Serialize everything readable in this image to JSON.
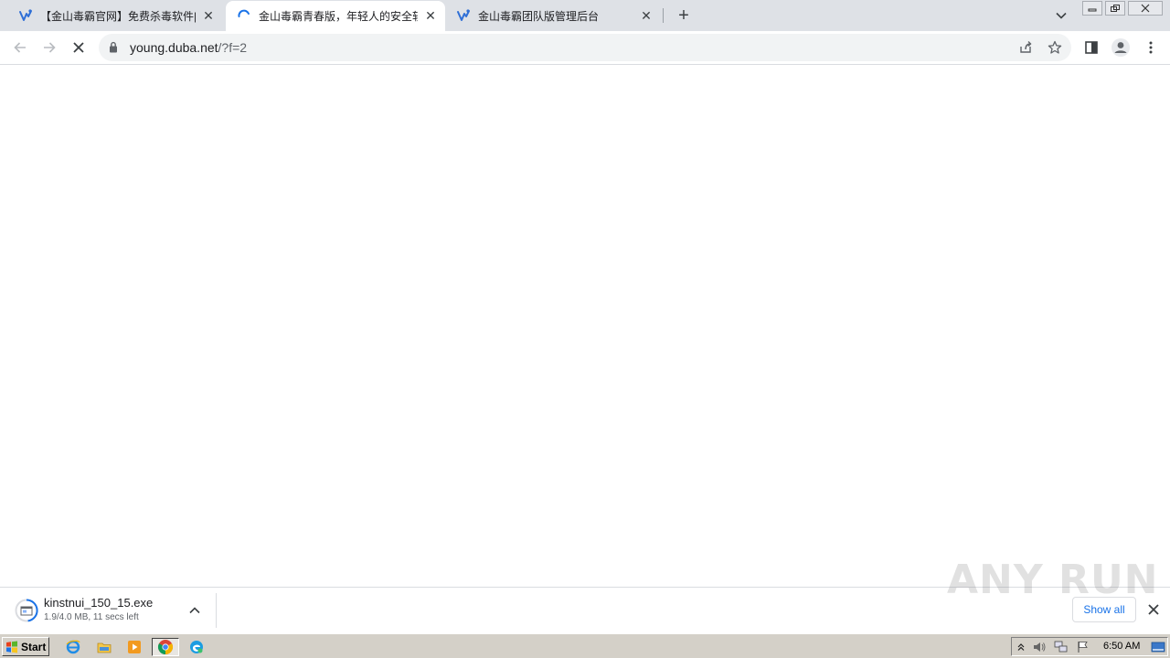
{
  "browser": {
    "tabs": [
      {
        "title": "【金山毒霸官网】免费杀毒软件|电脑杀毒",
        "state": "inactive",
        "favicon": "duba-logo-icon"
      },
      {
        "title": "金山毒霸青春版，年轻人的安全软件",
        "state": "active-loading",
        "favicon": "loading-spinner-icon"
      },
      {
        "title": "金山毒霸团队版管理后台",
        "state": "inactive",
        "favicon": "duba-logo-icon"
      }
    ],
    "new_tab_label": "+",
    "url_host": "young.duba.net",
    "url_path": "/?f=2"
  },
  "download_shelf": {
    "filename": "kinstnui_150_15.exe",
    "status": "1.9/4.0 MB, 11 secs left",
    "show_all_label": "Show all",
    "watermark": "ANY RUN"
  },
  "taskbar": {
    "start_label": "Start",
    "clock": "6:50 AM"
  },
  "colors": {
    "tabstrip_bg": "#dee1e6",
    "accent_blue": "#1a73e8",
    "taskbar_bg": "#d4d0c8"
  }
}
